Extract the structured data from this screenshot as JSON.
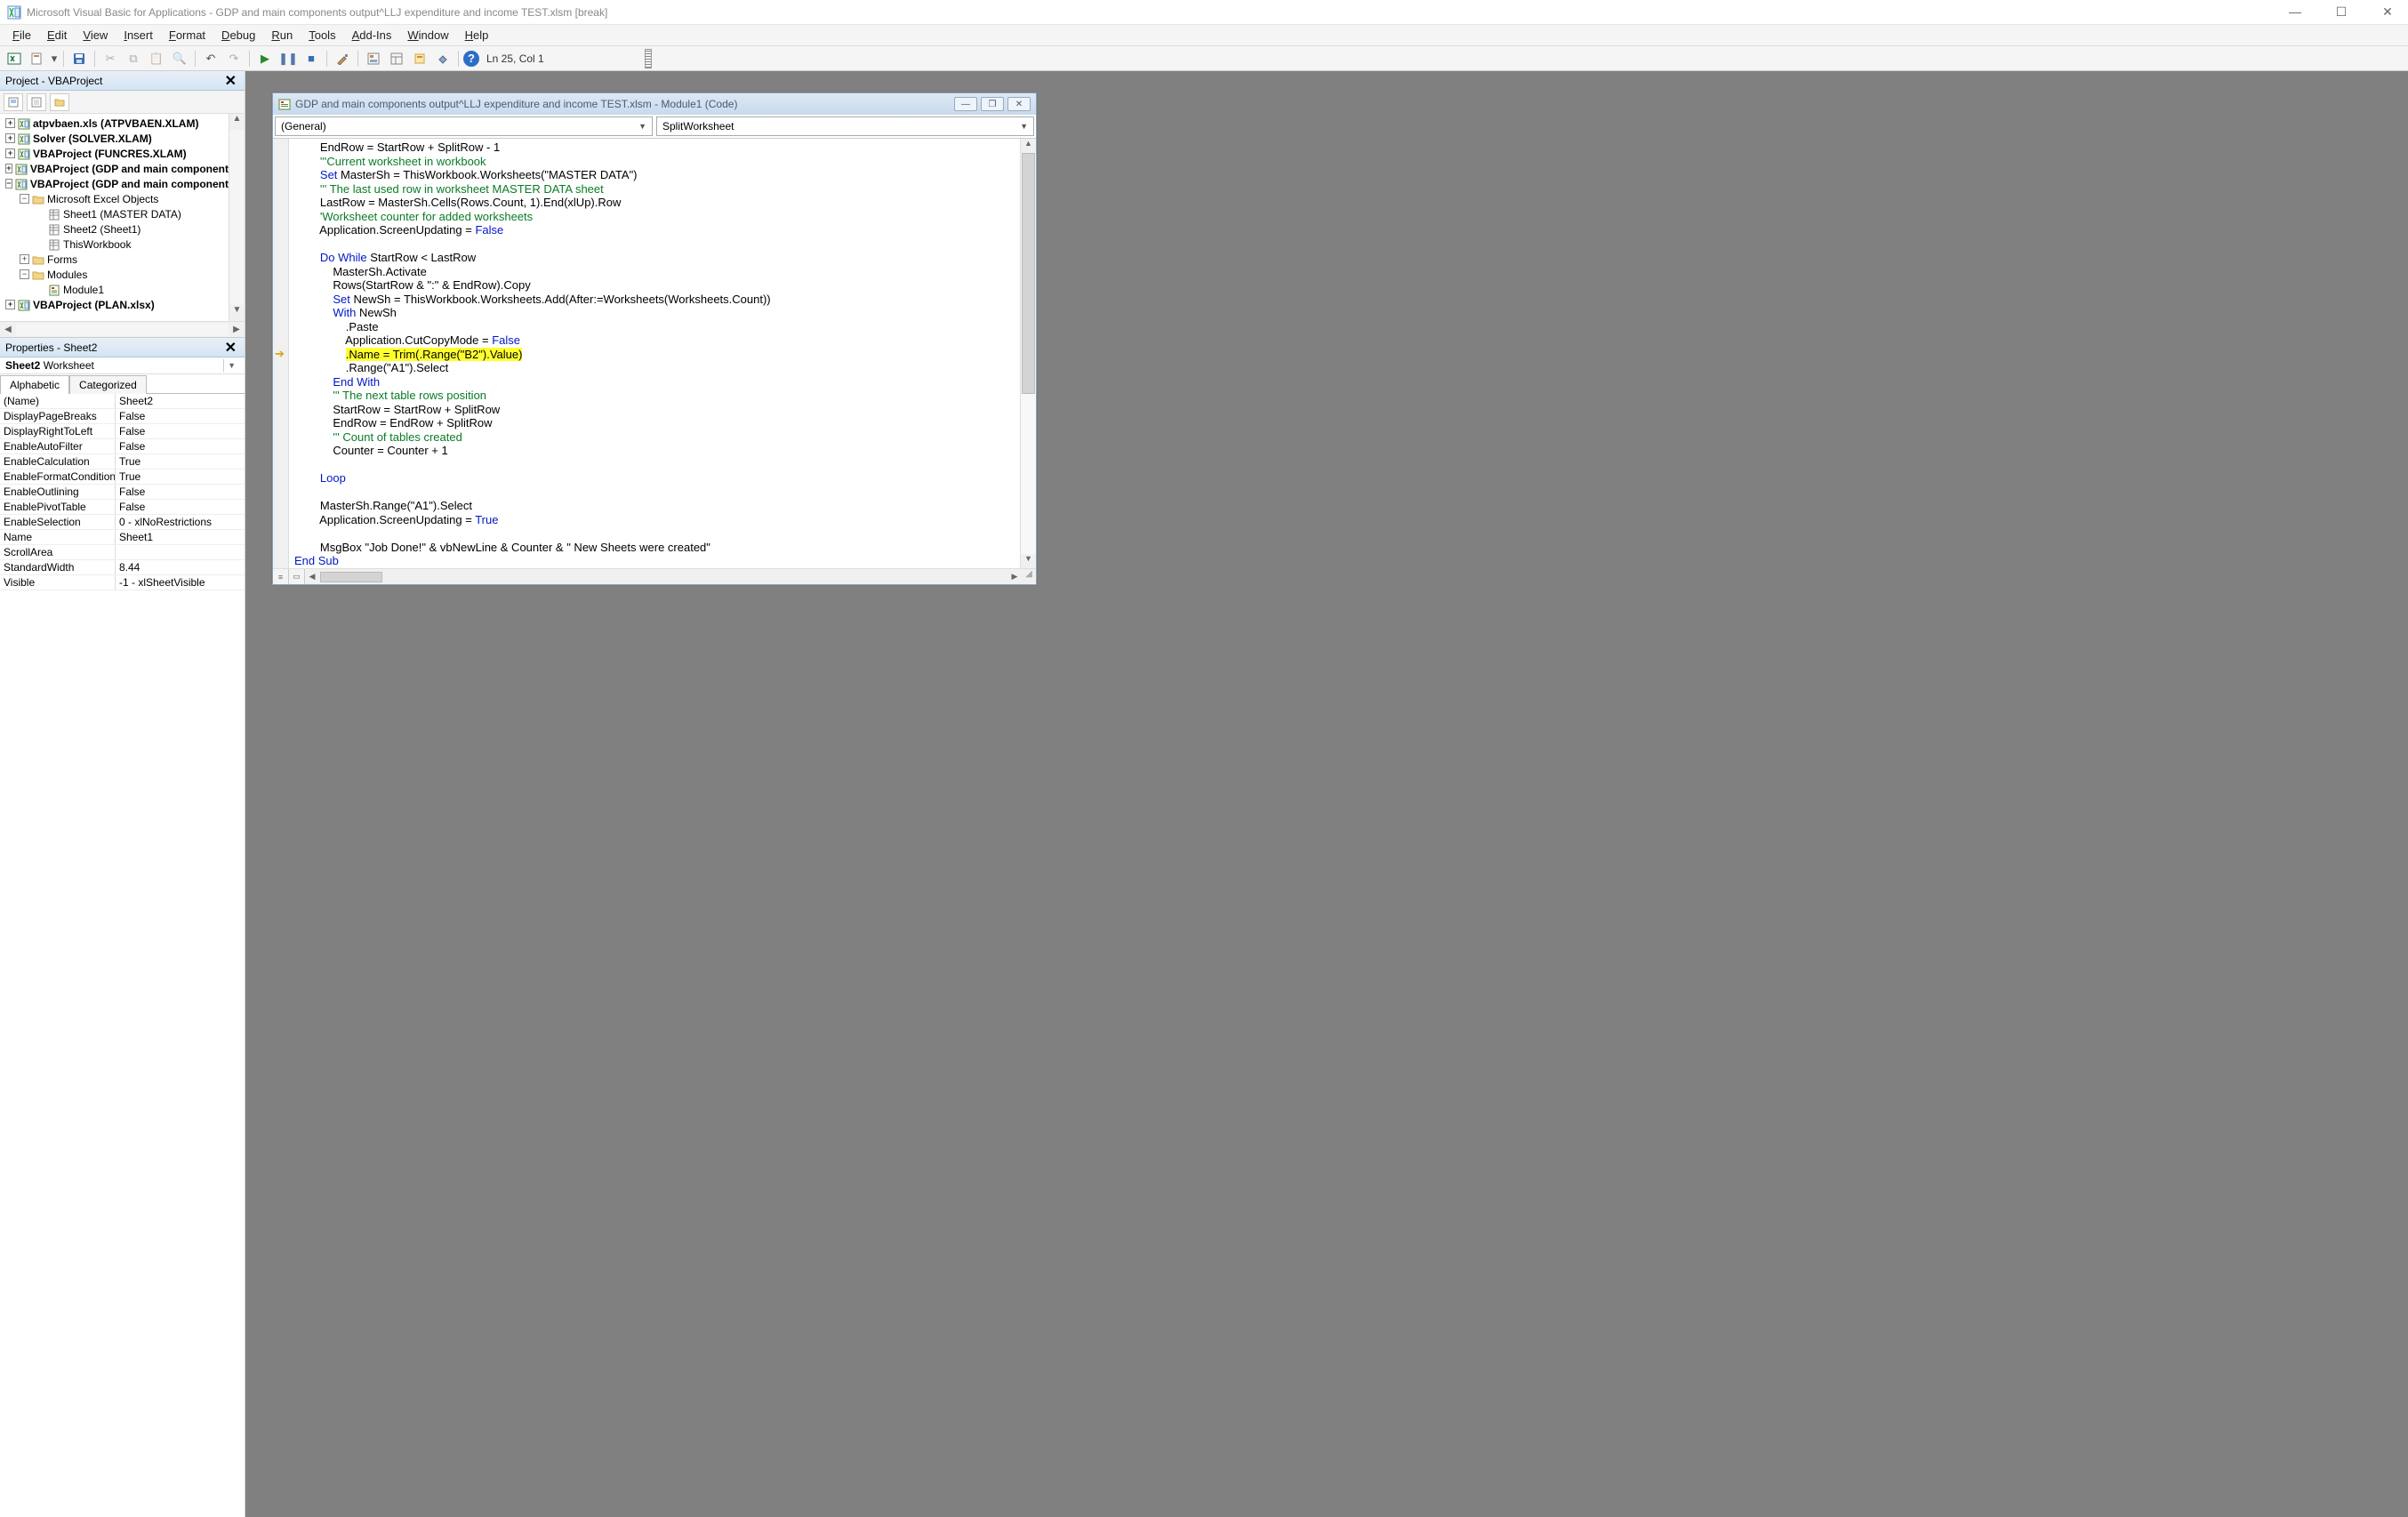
{
  "titlebar": {
    "title": "Microsoft Visual Basic for Applications - GDP and main components output^LLJ expenditure and income TEST.xlsm [break]"
  },
  "menus": [
    "File",
    "Edit",
    "View",
    "Insert",
    "Format",
    "Debug",
    "Run",
    "Tools",
    "Add-Ins",
    "Window",
    "Help"
  ],
  "toolbar_status": "Ln 25, Col 1",
  "project_panel": {
    "title": "Project - VBAProject",
    "tree": [
      {
        "lvl": 1,
        "exp": "+",
        "bold": true,
        "icon": "vba",
        "label": "atpvbaen.xls (ATPVBAEN.XLAM)"
      },
      {
        "lvl": 1,
        "exp": "+",
        "bold": true,
        "icon": "vba",
        "label": "Solver (SOLVER.XLAM)"
      },
      {
        "lvl": 1,
        "exp": "+",
        "bold": true,
        "icon": "vba",
        "label": "VBAProject (FUNCRES.XLAM)"
      },
      {
        "lvl": 1,
        "exp": "+",
        "bold": true,
        "icon": "vba",
        "label": "VBAProject (GDP and main component"
      },
      {
        "lvl": 1,
        "exp": "-",
        "bold": true,
        "icon": "vba",
        "label": "VBAProject (GDP and main component"
      },
      {
        "lvl": 2,
        "exp": "-",
        "bold": false,
        "icon": "folder",
        "label": "Microsoft Excel Objects"
      },
      {
        "lvl": 3,
        "exp": "",
        "bold": false,
        "icon": "sheet",
        "label": "Sheet1 (MASTER DATA)"
      },
      {
        "lvl": 3,
        "exp": "",
        "bold": false,
        "icon": "sheet",
        "label": "Sheet2 (Sheet1)"
      },
      {
        "lvl": 3,
        "exp": "",
        "bold": false,
        "icon": "sheet",
        "label": "ThisWorkbook"
      },
      {
        "lvl": 2,
        "exp": "+",
        "bold": false,
        "icon": "folder",
        "label": "Forms"
      },
      {
        "lvl": 2,
        "exp": "-",
        "bold": false,
        "icon": "folder",
        "label": "Modules"
      },
      {
        "lvl": 3,
        "exp": "",
        "bold": false,
        "icon": "module",
        "label": "Module1"
      },
      {
        "lvl": 1,
        "exp": "+",
        "bold": true,
        "icon": "vba",
        "label": "VBAProject (PLAN.xlsx)"
      }
    ]
  },
  "properties_panel": {
    "title": "Properties - Sheet2",
    "object_name_bold": "Sheet2",
    "object_name_rest": " Worksheet",
    "tabs": [
      "Alphabetic",
      "Categorized"
    ],
    "rows": [
      {
        "k": "(Name)",
        "v": "Sheet2"
      },
      {
        "k": "DisplayPageBreaks",
        "v": "False"
      },
      {
        "k": "DisplayRightToLeft",
        "v": "False"
      },
      {
        "k": "EnableAutoFilter",
        "v": "False"
      },
      {
        "k": "EnableCalculation",
        "v": "True"
      },
      {
        "k": "EnableFormatConditionsC",
        "v": "True"
      },
      {
        "k": "EnableOutlining",
        "v": "False"
      },
      {
        "k": "EnablePivotTable",
        "v": "False"
      },
      {
        "k": "EnableSelection",
        "v": "0 - xlNoRestrictions"
      },
      {
        "k": "Name",
        "v": "Sheet1"
      },
      {
        "k": "ScrollArea",
        "v": ""
      },
      {
        "k": "StandardWidth",
        "v": "8.44"
      },
      {
        "k": "Visible",
        "v": "-1 - xlSheetVisible"
      }
    ]
  },
  "code_window": {
    "title": "GDP and main components output^LLJ expenditure and income TEST.xlsm - Module1 (Code)",
    "dd_left": "(General)",
    "dd_right": "SplitWorksheet",
    "lines": [
      {
        "i": "        ",
        "t": [
          {
            "s": "",
            "c": "EndRow = StartRow + SplitRow - 1"
          }
        ]
      },
      {
        "i": "        ",
        "t": [
          {
            "s": "cm",
            "c": "'''Current worksheet in workbook"
          }
        ]
      },
      {
        "i": "        ",
        "t": [
          {
            "s": "kw",
            "c": "Set"
          },
          {
            "s": "",
            "c": " MasterSh = ThisWorkbook.Worksheets(\"MASTER DATA\")"
          }
        ]
      },
      {
        "i": "        ",
        "t": [
          {
            "s": "cm",
            "c": "''' The last used row in worksheet MASTER DATA sheet"
          }
        ]
      },
      {
        "i": "        ",
        "t": [
          {
            "s": "",
            "c": "LastRow = MasterSh.Cells(Rows.Count, 1).End(xlUp).Row"
          }
        ]
      },
      {
        "i": "        ",
        "t": [
          {
            "s": "cm",
            "c": "'Worksheet counter for added worksheets"
          }
        ]
      },
      {
        "i": "        ",
        "t": [
          {
            "s": "",
            "c": "Application.ScreenUpdating = "
          },
          {
            "s": "kw",
            "c": "False"
          }
        ]
      },
      {
        "i": "",
        "t": [
          {
            "s": "",
            "c": " "
          }
        ]
      },
      {
        "i": "        ",
        "t": [
          {
            "s": "kw",
            "c": "Do While"
          },
          {
            "s": "",
            "c": " StartRow < LastRow"
          }
        ]
      },
      {
        "i": "            ",
        "t": [
          {
            "s": "",
            "c": "MasterSh.Activate"
          }
        ]
      },
      {
        "i": "            ",
        "t": [
          {
            "s": "",
            "c": "Rows(StartRow & \":\" & EndRow).Copy"
          }
        ]
      },
      {
        "i": "            ",
        "t": [
          {
            "s": "kw",
            "c": "Set"
          },
          {
            "s": "",
            "c": " NewSh = ThisWorkbook.Worksheets.Add(After:=Worksheets(Worksheets.Count))"
          }
        ]
      },
      {
        "i": "            ",
        "t": [
          {
            "s": "kw",
            "c": "With"
          },
          {
            "s": "",
            "c": " NewSh"
          }
        ]
      },
      {
        "i": "                ",
        "t": [
          {
            "s": "",
            "c": ".Paste"
          }
        ]
      },
      {
        "i": "                ",
        "t": [
          {
            "s": "",
            "c": "Application.CutCopyMode = "
          },
          {
            "s": "kw",
            "c": "False"
          }
        ]
      },
      {
        "i": "                ",
        "t": [
          {
            "s": "hl",
            "c": ".Name = Trim(.Range(\"B2\").Value)"
          }
        ],
        "break": true
      },
      {
        "i": "                ",
        "t": [
          {
            "s": "",
            "c": ".Range(\"A1\").Select"
          }
        ]
      },
      {
        "i": "            ",
        "t": [
          {
            "s": "kw",
            "c": "End With"
          }
        ]
      },
      {
        "i": "            ",
        "t": [
          {
            "s": "cm",
            "c": "''' The next table rows position"
          }
        ]
      },
      {
        "i": "            ",
        "t": [
          {
            "s": "",
            "c": "StartRow = StartRow + SplitRow"
          }
        ]
      },
      {
        "i": "            ",
        "t": [
          {
            "s": "",
            "c": "EndRow = EndRow + SplitRow"
          }
        ]
      },
      {
        "i": "            ",
        "t": [
          {
            "s": "cm",
            "c": "''' Count of tables created"
          }
        ]
      },
      {
        "i": "            ",
        "t": [
          {
            "s": "",
            "c": "Counter = Counter + 1"
          }
        ]
      },
      {
        "i": "",
        "t": [
          {
            "s": "",
            "c": " "
          }
        ]
      },
      {
        "i": "        ",
        "t": [
          {
            "s": "kw",
            "c": "Loop"
          }
        ]
      },
      {
        "i": "",
        "t": [
          {
            "s": "",
            "c": " "
          }
        ]
      },
      {
        "i": "        ",
        "t": [
          {
            "s": "",
            "c": "MasterSh.Range(\"A1\").Select"
          }
        ]
      },
      {
        "i": "        ",
        "t": [
          {
            "s": "",
            "c": "Application.ScreenUpdating = "
          },
          {
            "s": "kw",
            "c": "True"
          }
        ]
      },
      {
        "i": "",
        "t": [
          {
            "s": "",
            "c": " "
          }
        ]
      },
      {
        "i": "        ",
        "t": [
          {
            "s": "",
            "c": "MsgBox \"Job Done!\" & vbNewLine & Counter & \" New Sheets were created\""
          }
        ]
      },
      {
        "i": "",
        "t": [
          {
            "s": "kw",
            "c": "End Sub"
          }
        ]
      }
    ]
  }
}
